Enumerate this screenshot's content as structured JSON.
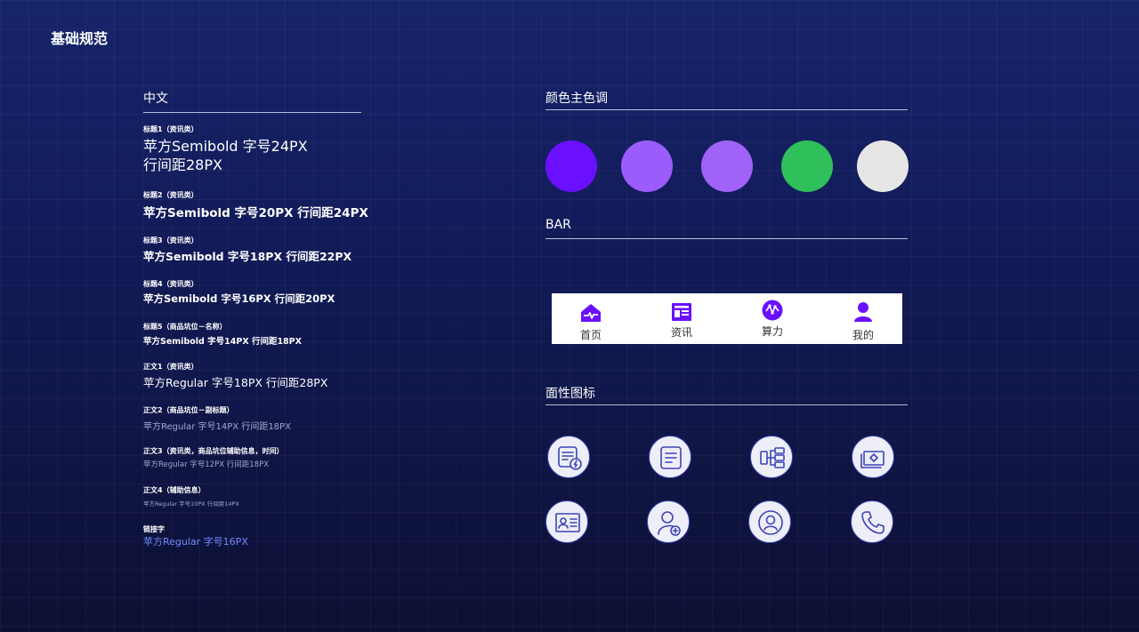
{
  "page_title": "基础规范",
  "chinese": {
    "title": "中文",
    "items": [
      {
        "label": "标题1（资讯类）",
        "sample_lines": [
          "苹方Semibold 字号24PX",
          "行间距28PX"
        ]
      },
      {
        "label": "标题2（资讯类）",
        "sample": "苹方Semibold 字号20PX 行间距24PX"
      },
      {
        "label": "标题3（资讯类）",
        "sample": "苹方Semibold 字号18PX 行间距22PX"
      },
      {
        "label": "标题4（资讯类）",
        "sample": "苹方Semibold 字号16PX 行间距20PX"
      },
      {
        "label": "标题5（商品坑位－名称）",
        "sample": "苹方Semibold 字号14PX 行间距18PX"
      },
      {
        "label": "正文1（资讯类）",
        "sample": "苹方Regular 字号18PX 行间距28PX"
      },
      {
        "label": "正文2（商品坑位－副标题）",
        "sample": "苹方Regular 字号14PX 行间距18PX"
      },
      {
        "label": "正文3（资讯类，商品坑位辅助信息，时间）",
        "sample": "苹方Regular 字号12PX 行间距18PX"
      },
      {
        "label": "正文4（辅助信息）",
        "sample": "苹方Regular 字号10PX 行间距14PX"
      },
      {
        "label": "链接字",
        "sample": "苹方Regular 字号16PX"
      }
    ],
    "link_color": "#6f8cff",
    "muted_color": "#a3a8c9"
  },
  "colors": {
    "title": "颜色主色调",
    "swatches": [
      "#6a10ff",
      "#9b5cfb",
      "#a062f7",
      "#2fbf5b",
      "#e6e6e6"
    ]
  },
  "bar": {
    "title": "BAR",
    "tabs": [
      {
        "label": "首页",
        "icon": "home-icon"
      },
      {
        "label": "资讯",
        "icon": "news-icon"
      },
      {
        "label": "算力",
        "icon": "computing-power-icon"
      },
      {
        "label": "我的",
        "icon": "profile-icon"
      }
    ],
    "accent": "#6a10ff"
  },
  "flat_icons": {
    "title": "面性图标",
    "icons": [
      "document-lightning-icon",
      "document-icon",
      "flowchart-icon",
      "ticket-icon",
      "id-card-icon",
      "add-user-icon",
      "user-circle-icon",
      "phone-icon"
    ],
    "stroke": "#3b44b5"
  }
}
